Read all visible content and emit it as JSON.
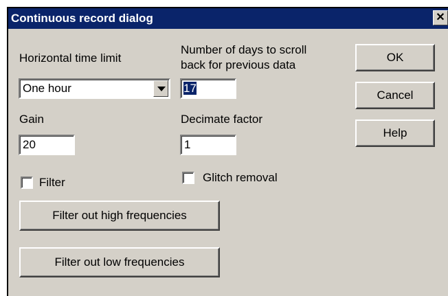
{
  "window": {
    "title": "Continuous record dialog",
    "close_glyph": "✕"
  },
  "horizontal_time_limit": {
    "label": "Horizontal time limit",
    "value": "One hour"
  },
  "days_scroll_back": {
    "label": "Number of days to scroll back for previous data",
    "value": "17"
  },
  "gain": {
    "label": "Gain",
    "value": "20"
  },
  "decimate_factor": {
    "label": "Decimate factor",
    "value": "1"
  },
  "filter_checkbox": {
    "label": "Filter",
    "checked": false
  },
  "glitch_removal_checkbox": {
    "label": "Glitch removal",
    "checked": false
  },
  "buttons": {
    "ok": "OK",
    "cancel": "Cancel",
    "help": "Help",
    "filter_high": "Filter out high frequencies",
    "filter_low": "Filter out low frequencies"
  },
  "colors": {
    "titlebar": "#0a246a",
    "dialog_face": "#d4d0c8"
  }
}
